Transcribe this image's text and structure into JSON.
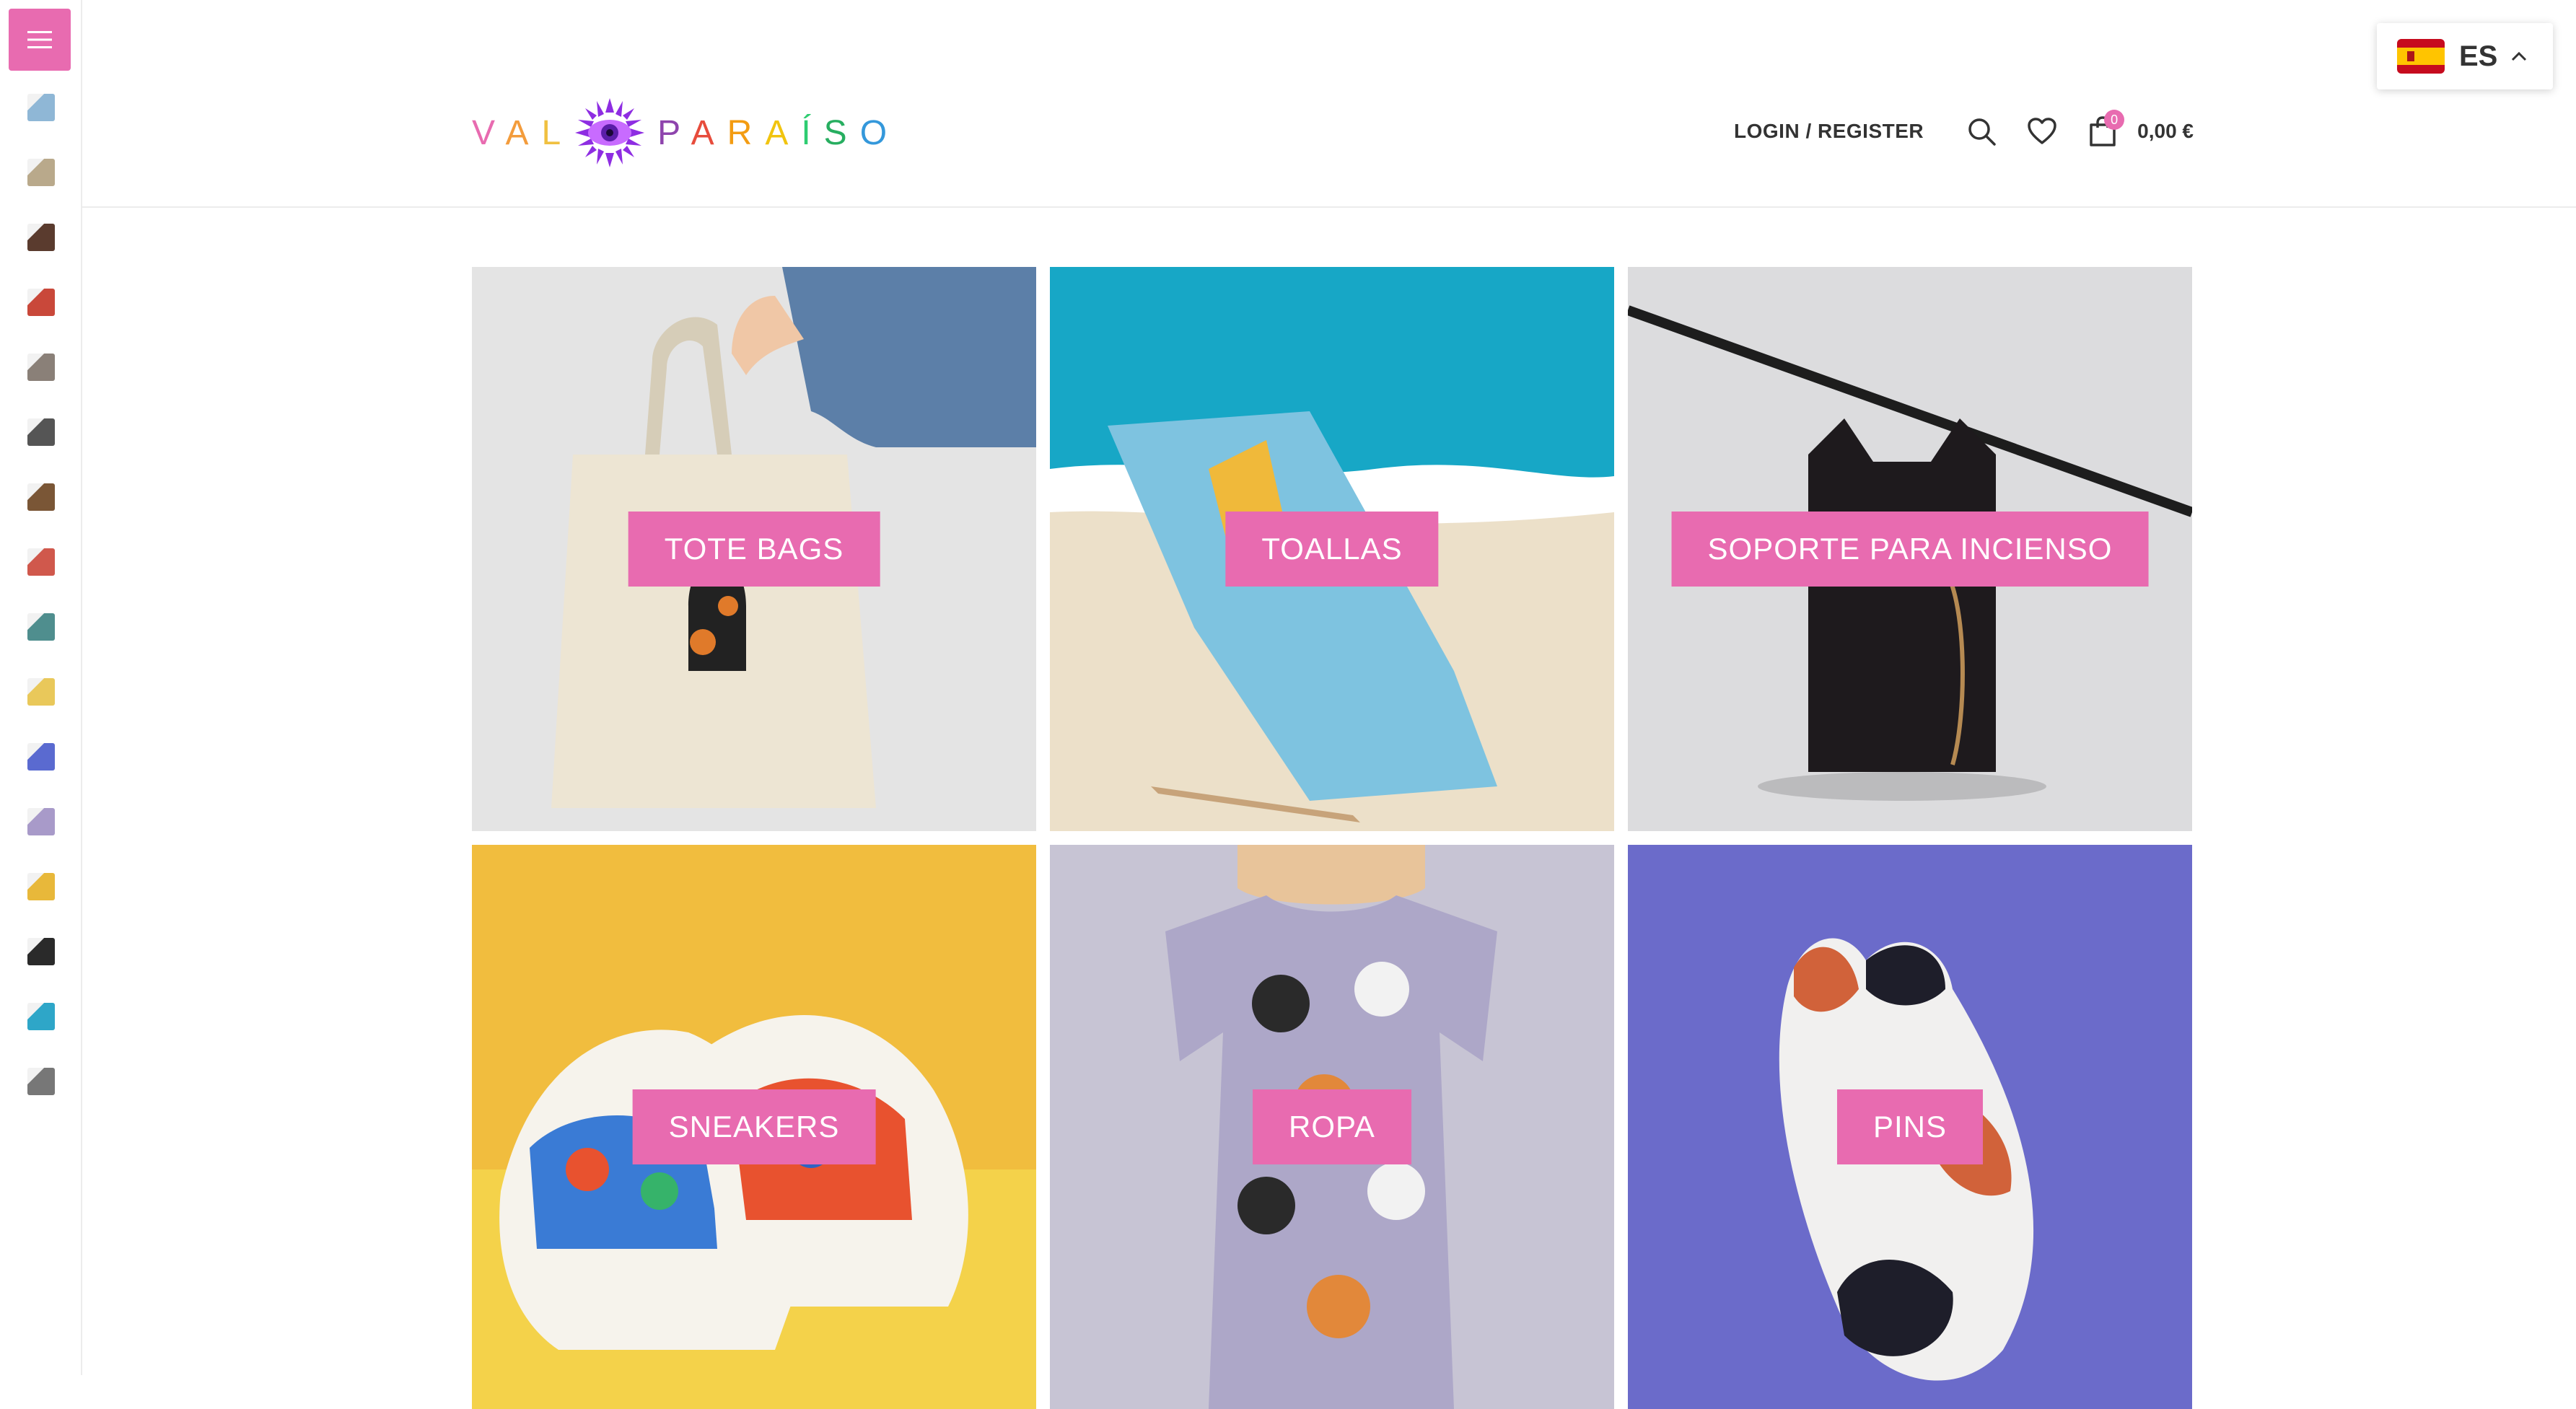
{
  "brand": {
    "accent_color": "#e86bb0",
    "logo_left": [
      "V",
      "A",
      "L"
    ],
    "logo_right": [
      "P",
      "A",
      "R",
      "A",
      "Í",
      "S",
      "O"
    ],
    "logo_left_colors": [
      "#e86bb0",
      "#f39c3c",
      "#f0c040"
    ],
    "logo_right_colors": [
      "#8e44ad",
      "#e74c3c",
      "#f39c12",
      "#f1c40f",
      "#2ecc71",
      "#27ae60",
      "#3498db"
    ]
  },
  "sidebar": {
    "menu_icon": "hamburger-icon",
    "thumbnails": [
      {
        "name": "thumb-1",
        "color": "#8fb7d6"
      },
      {
        "name": "thumb-2",
        "color": "#b9a98b"
      },
      {
        "name": "thumb-3",
        "color": "#5a3b2e"
      },
      {
        "name": "thumb-4",
        "color": "#c9483a"
      },
      {
        "name": "thumb-5",
        "color": "#8a8078"
      },
      {
        "name": "thumb-6",
        "color": "#555555"
      },
      {
        "name": "thumb-7",
        "color": "#7a5636"
      },
      {
        "name": "thumb-8",
        "color": "#d0584c"
      },
      {
        "name": "thumb-9",
        "color": "#4f8e8e"
      },
      {
        "name": "thumb-10",
        "color": "#e9c85a"
      },
      {
        "name": "thumb-11",
        "color": "#5a6ad0"
      },
      {
        "name": "thumb-12",
        "color": "#a89ac9"
      },
      {
        "name": "thumb-13",
        "color": "#e8b83a"
      },
      {
        "name": "thumb-14",
        "color": "#2a2a2a"
      },
      {
        "name": "thumb-15",
        "color": "#2ea6c8"
      },
      {
        "name": "thumb-16",
        "color": "#777777"
      }
    ]
  },
  "header": {
    "login_label": "LOGIN / REGISTER",
    "search_icon": "search-icon",
    "wishlist_icon": "heart-icon",
    "cart_icon": "shopping-bag-icon",
    "cart_count": "0",
    "cart_total": "0,00 €"
  },
  "language": {
    "code": "ES",
    "flag": "spain-flag-icon"
  },
  "categories": [
    {
      "label": "TOTE BAGS",
      "bg": "#e6e6e6"
    },
    {
      "label": "TOALLAS",
      "bg": "#1aa9c9"
    },
    {
      "label": "SOPORTE PARA INCIENSO",
      "bg": "#d9d9db"
    },
    {
      "label": "SNEAKERS",
      "bg": "#f3be3f"
    },
    {
      "label": "ROPA",
      "bg": "#c9c6d6"
    },
    {
      "label": "PINS",
      "bg": "#6a6ac9"
    }
  ]
}
